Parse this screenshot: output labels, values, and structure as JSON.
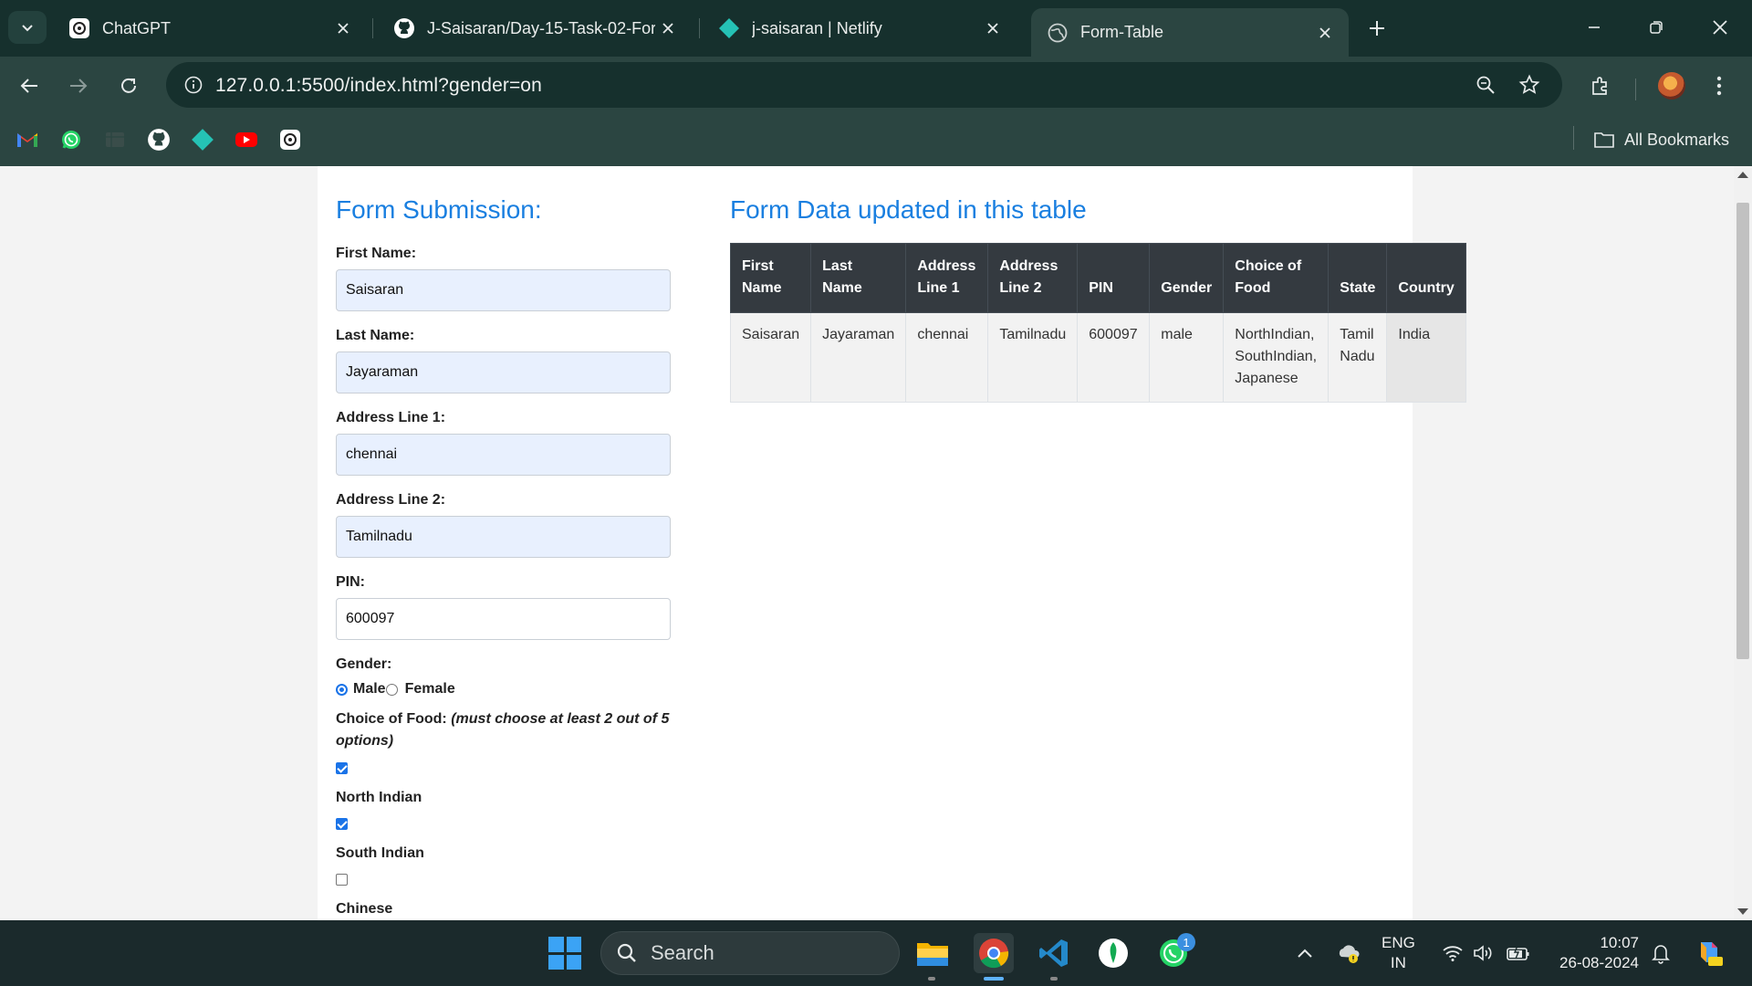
{
  "browser": {
    "tabs": [
      {
        "title": "ChatGPT",
        "icon": "chatgpt-icon"
      },
      {
        "title": "J-Saisaran/Day-15-Task-02-Form",
        "icon": "github-icon"
      },
      {
        "title": "j-saisaran | Netlify",
        "icon": "netlify-icon"
      },
      {
        "title": "Form-Table",
        "icon": "globe-icon",
        "active": true
      }
    ],
    "url": "127.0.0.1:5500/index.html?gender=on",
    "all_bookmarks_label": "All Bookmarks",
    "bookmarks": [
      "gmail-icon",
      "whatsapp-icon",
      "bookmark-icon",
      "github-icon",
      "netlify-icon",
      "youtube-icon",
      "chatgpt-icon"
    ]
  },
  "form": {
    "title": "Form Submission:",
    "first_name_label": "First Name:",
    "first_name_value": "Saisaran",
    "last_name_label": "Last Name:",
    "last_name_value": "Jayaraman",
    "address1_label": "Address Line 1:",
    "address1_value": "chennai",
    "address2_label": "Address Line 2:",
    "address2_value": "Tamilnadu",
    "pin_label": "PIN:",
    "pin_value": "600097",
    "gender_label": "Gender:",
    "gender_male": "Male",
    "gender_female": "Female",
    "gender_selected": "Male",
    "food_label": "Choice of Food:",
    "food_hint": "(must choose at least 2 out of 5 options)",
    "food_options": [
      {
        "label": "North Indian",
        "checked": true
      },
      {
        "label": "South Indian",
        "checked": true
      },
      {
        "label": "Chinese",
        "checked": false
      }
    ]
  },
  "table": {
    "title": "Form Data updated in this table",
    "headers": [
      "First Name",
      "Last Name",
      "Address Line 1",
      "Address Line 2",
      "PIN",
      "Gender",
      "Choice of Food",
      "State",
      "Country"
    ],
    "rows": [
      [
        "Saisaran",
        "Jayaraman",
        "chennai",
        "Tamilnadu",
        "600097",
        "male",
        "NorthIndian, SouthIndian, Japanese",
        "Tamil Nadu",
        "India"
      ]
    ]
  },
  "taskbar": {
    "search_label": "Search",
    "lang_top": "ENG",
    "lang_bottom": "IN",
    "time": "10:07",
    "date": "26-08-2024",
    "whatsapp_badge": "1"
  },
  "colors": {
    "accent_title": "#1a7fe0",
    "table_header_bg": "#343a40",
    "chrome_bg": "#2b4541",
    "tabbar_bg": "#16302d"
  }
}
